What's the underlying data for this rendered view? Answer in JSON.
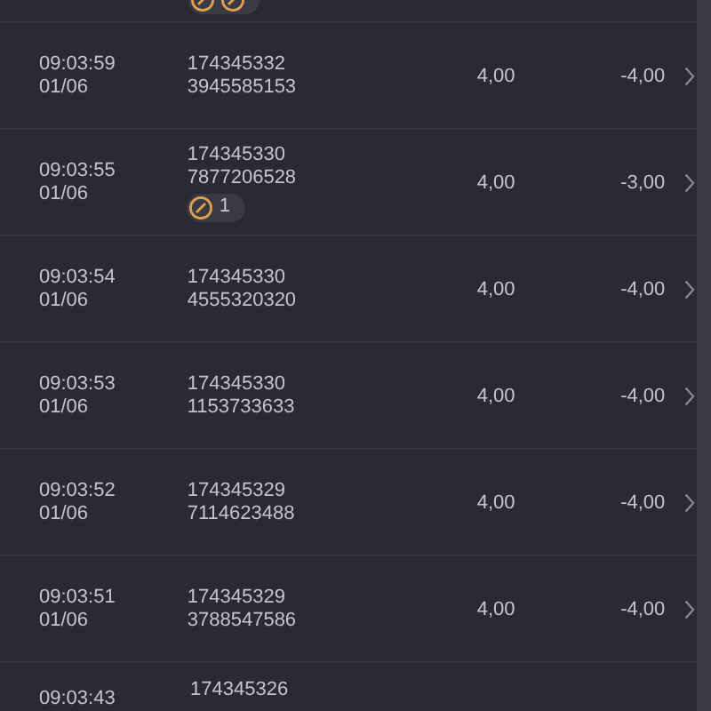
{
  "rows": [
    {
      "time": "09:03:59",
      "date": "01/06",
      "id_line_1": "174345332",
      "id_line_2": "3945585153",
      "amount": "4,00",
      "result": "-4,00"
    },
    {
      "time": "09:03:55",
      "date": "01/06",
      "id_line_1": "174345330",
      "id_line_2": "7877206528",
      "badge_count": "1",
      "amount": "4,00",
      "result": "-3,00"
    },
    {
      "time": "09:03:54",
      "date": "01/06",
      "id_line_1": "174345330",
      "id_line_2": "4555320320",
      "amount": "4,00",
      "result": "-4,00"
    },
    {
      "time": "09:03:53",
      "date": "01/06",
      "id_line_1": "174345330",
      "id_line_2": "1153733633",
      "amount": "4,00",
      "result": "-4,00"
    },
    {
      "time": "09:03:52",
      "date": "01/06",
      "id_line_1": "174345329",
      "id_line_2": "7114623488",
      "amount": "4,00",
      "result": "-4,00"
    },
    {
      "time": "09:03:51",
      "date": "01/06",
      "id_line_1": "174345329",
      "id_line_2": "3788547586",
      "amount": "4,00",
      "result": "-4,00"
    }
  ],
  "partial_row": {
    "time": "09:03:43",
    "id_line_1": "174345326"
  }
}
